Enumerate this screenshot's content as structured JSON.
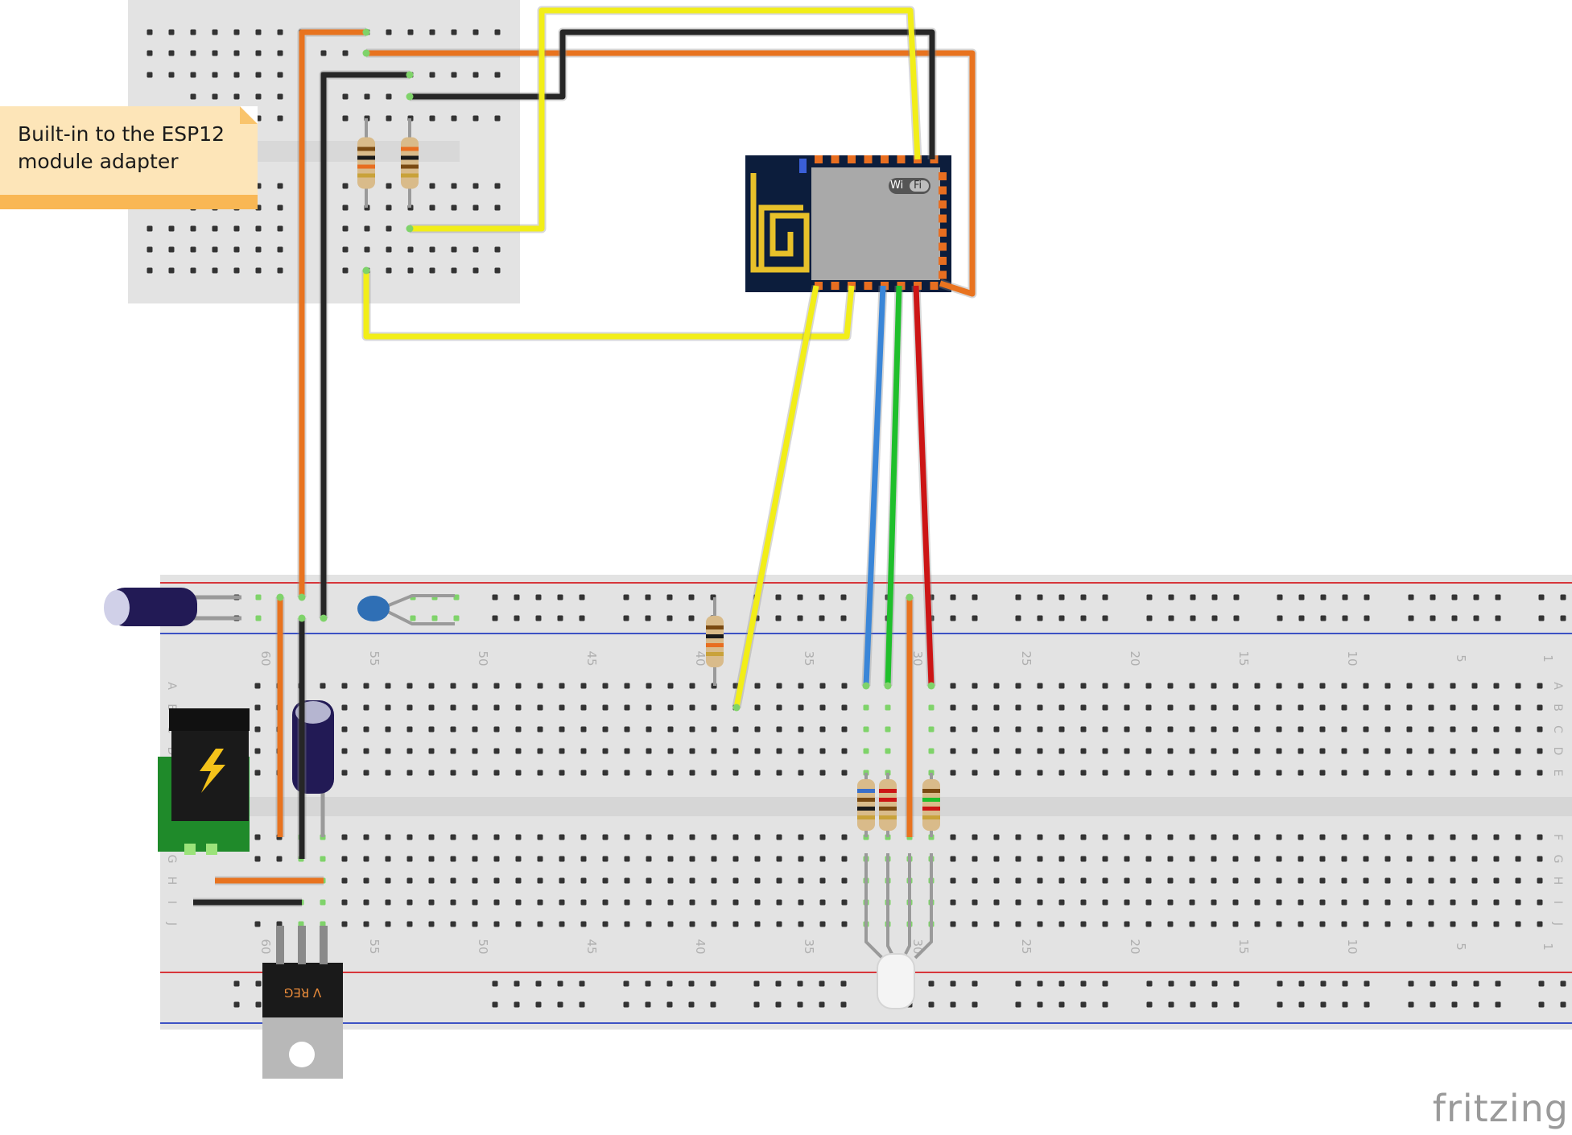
{
  "note": {
    "text": "Built-in to the ESP12\nmodule adapter"
  },
  "brand": "fritzing",
  "module": {
    "badge_left": "Wi",
    "badge_right": "Fi"
  },
  "regulator": {
    "label": "V REG"
  },
  "breadboard": {
    "column_numbers": [
      "60",
      "55",
      "50",
      "45",
      "40",
      "35",
      "30",
      "25",
      "20",
      "15",
      "10",
      "5",
      "1"
    ],
    "row_letters_top": [
      "A",
      "B",
      "C",
      "D",
      "E"
    ],
    "row_letters_bottom": [
      "F",
      "G",
      "H",
      "I",
      "J"
    ]
  },
  "colors": {
    "wire_orange": "#e8731f",
    "wire_black": "#262626",
    "wire_yellow": "#f2ee18",
    "wire_blue": "#3a86d8",
    "wire_green": "#1fbf2b",
    "wire_red": "#cc1515",
    "breadboard": "#e3e3e3",
    "rail_red": "#d7363b",
    "rail_blue": "#3d52c4",
    "note_bg": "#fde5b8",
    "note_bar": "#f9b754",
    "esp_board": "#0c1d3c",
    "esp_shield": "#a9a9a9",
    "led_hole": "#7fd36a"
  }
}
